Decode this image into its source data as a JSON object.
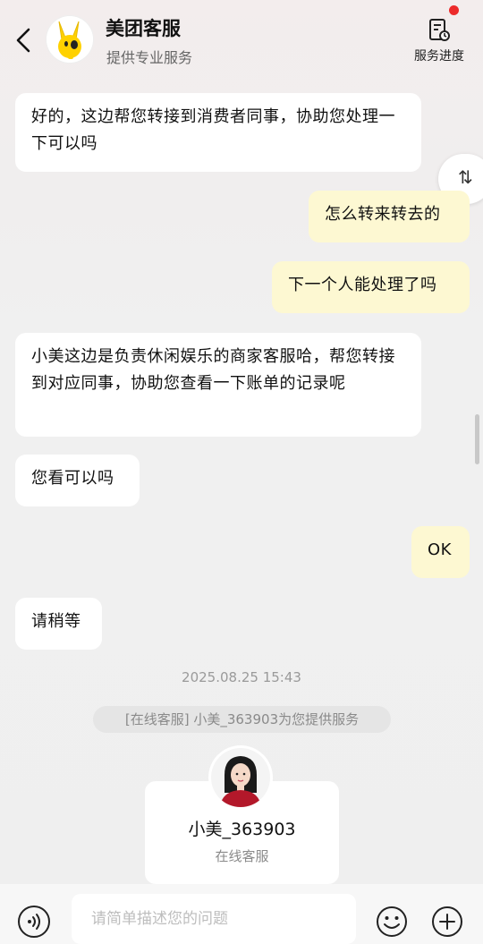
{
  "header": {
    "title": "美团客服",
    "subtitle": "提供专业服务",
    "progress_label": "服务进度",
    "accent_color": "#ffd100",
    "notification_dot_color": "#ec2a2a"
  },
  "side_button": {
    "icon": "transfer-arrows-icon",
    "glyph": "⇅"
  },
  "messages": [
    {
      "side": "left",
      "text": "好的，这边帮您转接到消费者同事，协助您处理一下可以吗"
    },
    {
      "side": "right",
      "text": "怎么转来转去的"
    },
    {
      "side": "right",
      "text": "下一个人能处理了吗"
    },
    {
      "side": "left",
      "text": "小美这边是负责休闲娱乐的商家客服哈，帮您转接到对应同事，协助您查看一下账单的记录呢"
    },
    {
      "side": "left",
      "text": "您看可以吗"
    },
    {
      "side": "right",
      "text": "OK"
    },
    {
      "side": "left",
      "text": "请稍等"
    }
  ],
  "timestamp": "2025.08.25 15:43",
  "system_note": "[在线客服] 小美_363903为您提供服务",
  "agent": {
    "name": "小美_363903",
    "role": "在线客服"
  },
  "bottom": {
    "input_placeholder": "请简单描述您的问题",
    "voice_icon": "voice-icon",
    "emoji_icon": "emoji-icon",
    "plus_icon": "plus-icon"
  }
}
